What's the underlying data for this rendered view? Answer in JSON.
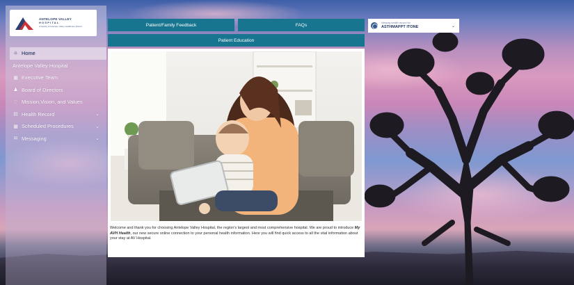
{
  "logo": {
    "line1": "ANTELOPE VALLEY",
    "line2": "HOSPITAL",
    "line3": "A Facility of Antelope Valley Healthcare District"
  },
  "nav": {
    "items": [
      {
        "label": "Home",
        "icon": "home-icon"
      },
      {
        "label": "Antelope Valley Hospital",
        "icon": ""
      },
      {
        "label": "Executive Team",
        "icon": "building-icon"
      },
      {
        "label": "Board of Directors",
        "icon": "people-icon"
      },
      {
        "label": "Mission,Vision, and Values",
        "icon": "heart-icon"
      },
      {
        "label": "Health Record",
        "icon": "record-icon"
      },
      {
        "label": "Scheduled Procedures",
        "icon": "calendar-icon"
      },
      {
        "label": "Messaging",
        "icon": "envelope-icon"
      }
    ]
  },
  "buttons": {
    "feedback": "Patient/Family Feedback",
    "faqs": "FAQs",
    "education": "Patient Education"
  },
  "record_select": {
    "label": "Viewing health record for",
    "value": "ASTHMAPPT ITONE"
  },
  "welcome": {
    "part1": "Welcome and thank you for choosing Antelope Valley Hospital, the region's largest and most comprehensive hospital. We are proud to introduce ",
    "brand": "My AVH Health",
    "part2": ", our new secure online connection to your personal health information. Here you will find quick access to all the vital information about your stay at AV Hospital."
  },
  "colors": {
    "button_bg": "#177590",
    "brand_navy": "#2d3e70",
    "brand_red": "#c8323a"
  }
}
